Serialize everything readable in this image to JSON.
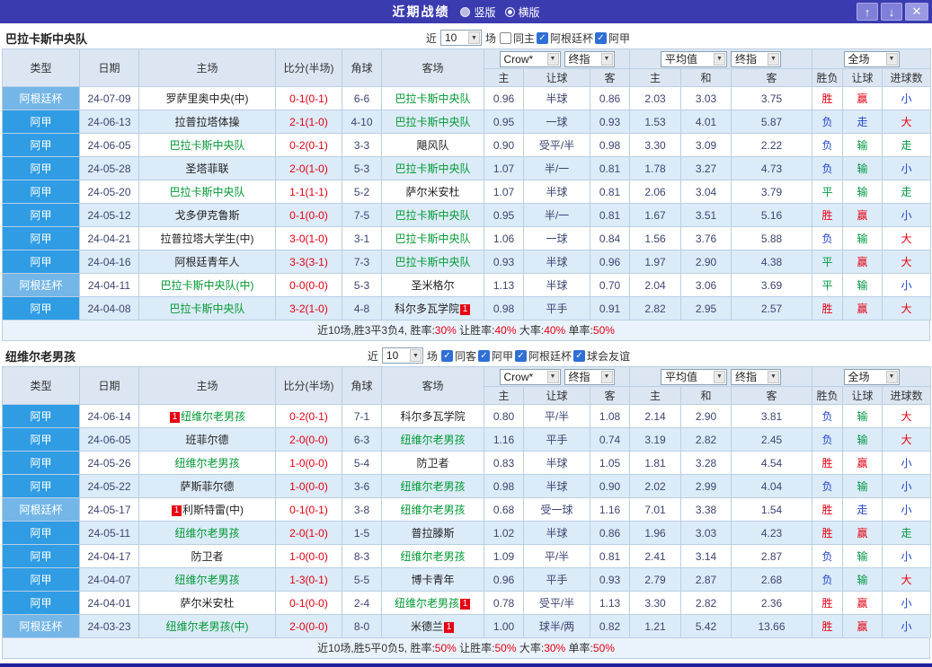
{
  "topbar": {
    "title": "近期战绩",
    "radios": [
      {
        "label": "竖版",
        "selected": false
      },
      {
        "label": "横版",
        "selected": true
      }
    ],
    "up_icon": "↑",
    "down_icon": "↓",
    "close_icon": "✕"
  },
  "icons": {
    "dropdown_arrow": "▼",
    "check": "✓"
  },
  "table_header": {
    "static_cols": [
      "类型",
      "日期",
      "主场",
      "比分(半场)",
      "角球",
      "客场"
    ],
    "group1": {
      "selects": [
        "Crow*",
        "终指"
      ],
      "cols": [
        "主",
        "让球",
        "客"
      ]
    },
    "group2": {
      "selects": [
        "平均值",
        "终指"
      ],
      "cols": [
        "主",
        "和",
        "客"
      ]
    },
    "group3": {
      "selects": [
        "全场"
      ],
      "cols": [
        "胜负",
        "让球",
        "进球数"
      ]
    }
  },
  "type_colors": {
    "阿甲": "#2f9ce4",
    "阿根廷杯": "#74b6e8"
  },
  "result_colors": {
    "winloss": {
      "胜": "#e60012",
      "平": "#009944",
      "负": "#2244cc"
    },
    "handicap": {
      "赢": "#e60012",
      "输": "#009944",
      "走": "#2244cc"
    },
    "goals": {
      "大": "#e60012",
      "小": "#2244cc",
      "走": "#009944"
    }
  },
  "sections": [
    {
      "team": "巴拉卡斯中央队",
      "filters": {
        "near_label": "近",
        "near_value": "10",
        "games_label": "场",
        "checkboxes": [
          {
            "label": "同主",
            "checked": false
          },
          {
            "label": "阿根廷杯",
            "checked": true
          },
          {
            "label": "阿甲",
            "checked": true
          }
        ]
      },
      "rows": [
        {
          "type": "阿根廷杯",
          "date": "24-07-09",
          "home": {
            "name": "罗萨里奥中央(中)"
          },
          "score": "0-1(0-1)",
          "corner": "6-6",
          "away": {
            "name": "巴拉卡斯中央队",
            "focal": true
          },
          "odds": [
            "0.96",
            "半球",
            "0.86"
          ],
          "avg": [
            "2.03",
            "3.03",
            "3.75"
          ],
          "results": [
            "胜",
            "赢",
            "小"
          ]
        },
        {
          "type": "阿甲",
          "date": "24-06-13",
          "home": {
            "name": "拉普拉塔体操"
          },
          "score": "2-1(1-0)",
          "corner": "4-10",
          "away": {
            "name": "巴拉卡斯中央队",
            "focal": true
          },
          "odds": [
            "0.95",
            "一球",
            "0.93"
          ],
          "avg": [
            "1.53",
            "4.01",
            "5.87"
          ],
          "results": [
            "负",
            "走",
            "大"
          ]
        },
        {
          "type": "阿甲",
          "date": "24-06-05",
          "home": {
            "name": "巴拉卡斯中央队",
            "focal": true
          },
          "score": "0-2(0-1)",
          "corner": "3-3",
          "away": {
            "name": "飓风队"
          },
          "odds": [
            "0.90",
            "受平/半",
            "0.98"
          ],
          "avg": [
            "3.30",
            "3.09",
            "2.22"
          ],
          "results": [
            "负",
            "输",
            "走"
          ]
        },
        {
          "type": "阿甲",
          "date": "24-05-28",
          "home": {
            "name": "圣塔菲联"
          },
          "score": "2-0(1-0)",
          "corner": "5-3",
          "away": {
            "name": "巴拉卡斯中央队",
            "focal": true
          },
          "odds": [
            "1.07",
            "半/一",
            "0.81"
          ],
          "avg": [
            "1.78",
            "3.27",
            "4.73"
          ],
          "results": [
            "负",
            "输",
            "小"
          ]
        },
        {
          "type": "阿甲",
          "date": "24-05-20",
          "home": {
            "name": "巴拉卡斯中央队",
            "focal": true
          },
          "score": "1-1(1-1)",
          "corner": "5-2",
          "away": {
            "name": "萨尔米安杜"
          },
          "odds": [
            "1.07",
            "半球",
            "0.81"
          ],
          "avg": [
            "2.06",
            "3.04",
            "3.79"
          ],
          "results": [
            "平",
            "输",
            "走"
          ]
        },
        {
          "type": "阿甲",
          "date": "24-05-12",
          "home": {
            "name": "戈多伊克鲁斯"
          },
          "score": "0-1(0-0)",
          "corner": "7-5",
          "away": {
            "name": "巴拉卡斯中央队",
            "focal": true
          },
          "odds": [
            "0.95",
            "半/一",
            "0.81"
          ],
          "avg": [
            "1.67",
            "3.51",
            "5.16"
          ],
          "results": [
            "胜",
            "赢",
            "小"
          ]
        },
        {
          "type": "阿甲",
          "date": "24-04-21",
          "home": {
            "name": "拉普拉塔大学生(中)"
          },
          "score": "3-0(1-0)",
          "corner": "3-1",
          "away": {
            "name": "巴拉卡斯中央队",
            "focal": true
          },
          "odds": [
            "1.06",
            "一球",
            "0.84"
          ],
          "avg": [
            "1.56",
            "3.76",
            "5.88"
          ],
          "results": [
            "负",
            "输",
            "大"
          ]
        },
        {
          "type": "阿甲",
          "date": "24-04-16",
          "home": {
            "name": "阿根廷青年人"
          },
          "score": "3-3(3-1)",
          "corner": "7-3",
          "away": {
            "name": "巴拉卡斯中央队",
            "focal": true
          },
          "odds": [
            "0.93",
            "半球",
            "0.96"
          ],
          "avg": [
            "1.97",
            "2.90",
            "4.38"
          ],
          "results": [
            "平",
            "赢",
            "大"
          ]
        },
        {
          "type": "阿根廷杯",
          "date": "24-04-11",
          "home": {
            "name": "巴拉卡斯中央队(中)",
            "focal": true
          },
          "score": "0-0(0-0)",
          "corner": "5-3",
          "away": {
            "name": "圣米格尔"
          },
          "odds": [
            "1.13",
            "半球",
            "0.70"
          ],
          "avg": [
            "2.04",
            "3.06",
            "3.69"
          ],
          "results": [
            "平",
            "输",
            "小"
          ]
        },
        {
          "type": "阿甲",
          "date": "24-04-08",
          "home": {
            "name": "巴拉卡斯中央队",
            "focal": true
          },
          "score": "3-2(1-0)",
          "corner": "4-8",
          "away": {
            "name": "科尔多瓦学院",
            "badge_after": "1"
          },
          "odds": [
            "0.98",
            "平手",
            "0.91"
          ],
          "avg": [
            "2.82",
            "2.95",
            "2.57"
          ],
          "results": [
            "胜",
            "赢",
            "大"
          ]
        }
      ],
      "summary": [
        {
          "text": "近10场,胜3平3负4, ",
          "red": false
        },
        {
          "text": "胜率:",
          "red": false
        },
        {
          "text": "30%",
          "red": true
        },
        {
          "text": " 让胜率:",
          "red": false
        },
        {
          "text": "40%",
          "red": true
        },
        {
          "text": " 大率:",
          "red": false
        },
        {
          "text": "40%",
          "red": true
        },
        {
          "text": " 单率:",
          "red": false
        },
        {
          "text": "50%",
          "red": true
        }
      ]
    },
    {
      "team": "纽维尔老男孩",
      "filters": {
        "near_label": "近",
        "near_value": "10",
        "games_label": "场",
        "checkboxes": [
          {
            "label": "同客",
            "checked": true
          },
          {
            "label": "阿甲",
            "checked": true
          },
          {
            "label": "阿根廷杯",
            "checked": true
          },
          {
            "label": "球会友谊",
            "checked": true
          }
        ]
      },
      "rows": [
        {
          "type": "阿甲",
          "date": "24-06-14",
          "home": {
            "name": "纽维尔老男孩",
            "focal": true,
            "badge_before": "1"
          },
          "score": "0-2(0-1)",
          "corner": "7-1",
          "away": {
            "name": "科尔多瓦学院"
          },
          "odds": [
            "0.80",
            "平/半",
            "1.08"
          ],
          "avg": [
            "2.14",
            "2.90",
            "3.81"
          ],
          "results": [
            "负",
            "输",
            "大"
          ]
        },
        {
          "type": "阿甲",
          "date": "24-06-05",
          "home": {
            "name": "班菲尔德"
          },
          "score": "2-0(0-0)",
          "corner": "6-3",
          "away": {
            "name": "纽维尔老男孩",
            "focal": true
          },
          "odds": [
            "1.16",
            "平手",
            "0.74"
          ],
          "avg": [
            "3.19",
            "2.82",
            "2.45"
          ],
          "results": [
            "负",
            "输",
            "大"
          ]
        },
        {
          "type": "阿甲",
          "date": "24-05-26",
          "home": {
            "name": "纽维尔老男孩",
            "focal": true
          },
          "score": "1-0(0-0)",
          "corner": "5-4",
          "away": {
            "name": "防卫者"
          },
          "odds": [
            "0.83",
            "半球",
            "1.05"
          ],
          "avg": [
            "1.81",
            "3.28",
            "4.54"
          ],
          "results": [
            "胜",
            "赢",
            "小"
          ]
        },
        {
          "type": "阿甲",
          "date": "24-05-22",
          "home": {
            "name": "萨斯菲尔德"
          },
          "score": "1-0(0-0)",
          "corner": "3-6",
          "away": {
            "name": "纽维尔老男孩",
            "focal": true
          },
          "odds": [
            "0.98",
            "半球",
            "0.90"
          ],
          "avg": [
            "2.02",
            "2.99",
            "4.04"
          ],
          "results": [
            "负",
            "输",
            "小"
          ]
        },
        {
          "type": "阿根廷杯",
          "date": "24-05-17",
          "home": {
            "name": "利斯特雷(中)",
            "badge_before": "1"
          },
          "score": "0-1(0-1)",
          "corner": "3-8",
          "away": {
            "name": "纽维尔老男孩",
            "focal": true
          },
          "odds": [
            "0.68",
            "受一球",
            "1.16"
          ],
          "avg": [
            "7.01",
            "3.38",
            "1.54"
          ],
          "results": [
            "胜",
            "走",
            "小"
          ]
        },
        {
          "type": "阿甲",
          "date": "24-05-11",
          "home": {
            "name": "纽维尔老男孩",
            "focal": true
          },
          "score": "2-0(1-0)",
          "corner": "1-5",
          "away": {
            "name": "普拉滕斯"
          },
          "odds": [
            "1.02",
            "半球",
            "0.86"
          ],
          "avg": [
            "1.96",
            "3.03",
            "4.23"
          ],
          "results": [
            "胜",
            "赢",
            "走"
          ]
        },
        {
          "type": "阿甲",
          "date": "24-04-17",
          "home": {
            "name": "防卫者"
          },
          "score": "1-0(0-0)",
          "corner": "8-3",
          "away": {
            "name": "纽维尔老男孩",
            "focal": true
          },
          "odds": [
            "1.09",
            "平/半",
            "0.81"
          ],
          "avg": [
            "2.41",
            "3.14",
            "2.87"
          ],
          "results": [
            "负",
            "输",
            "小"
          ]
        },
        {
          "type": "阿甲",
          "date": "24-04-07",
          "home": {
            "name": "纽维尔老男孩",
            "focal": true
          },
          "score": "1-3(0-1)",
          "corner": "5-5",
          "away": {
            "name": "博卡青年"
          },
          "odds": [
            "0.96",
            "平手",
            "0.93"
          ],
          "avg": [
            "2.79",
            "2.87",
            "2.68"
          ],
          "results": [
            "负",
            "输",
            "大"
          ]
        },
        {
          "type": "阿甲",
          "date": "24-04-01",
          "home": {
            "name": "萨尔米安杜"
          },
          "score": "0-1(0-0)",
          "corner": "2-4",
          "away": {
            "name": "纽维尔老男孩",
            "focal": true,
            "badge_after": "1"
          },
          "odds": [
            "0.78",
            "受平/半",
            "1.13"
          ],
          "avg": [
            "3.30",
            "2.82",
            "2.36"
          ],
          "results": [
            "胜",
            "赢",
            "小"
          ]
        },
        {
          "type": "阿根廷杯",
          "date": "24-03-23",
          "home": {
            "name": "纽维尔老男孩(中)",
            "focal": true
          },
          "score": "2-0(0-0)",
          "corner": "8-0",
          "away": {
            "name": "米德兰",
            "badge_after": "1"
          },
          "odds": [
            "1.00",
            "球半/两",
            "0.82"
          ],
          "avg": [
            "1.21",
            "5.42",
            "13.66"
          ],
          "results": [
            "胜",
            "赢",
            "小"
          ]
        }
      ],
      "summary": [
        {
          "text": "近10场,胜5平0负5, ",
          "red": false
        },
        {
          "text": "胜率:",
          "red": false
        },
        {
          "text": "50%",
          "red": true
        },
        {
          "text": " 让胜率:",
          "red": false
        },
        {
          "text": "50%",
          "red": true
        },
        {
          "text": " 大率:",
          "red": false
        },
        {
          "text": "30%",
          "red": true
        },
        {
          "text": " 单率:",
          "red": false
        },
        {
          "text": "50%",
          "red": true
        }
      ]
    }
  ]
}
